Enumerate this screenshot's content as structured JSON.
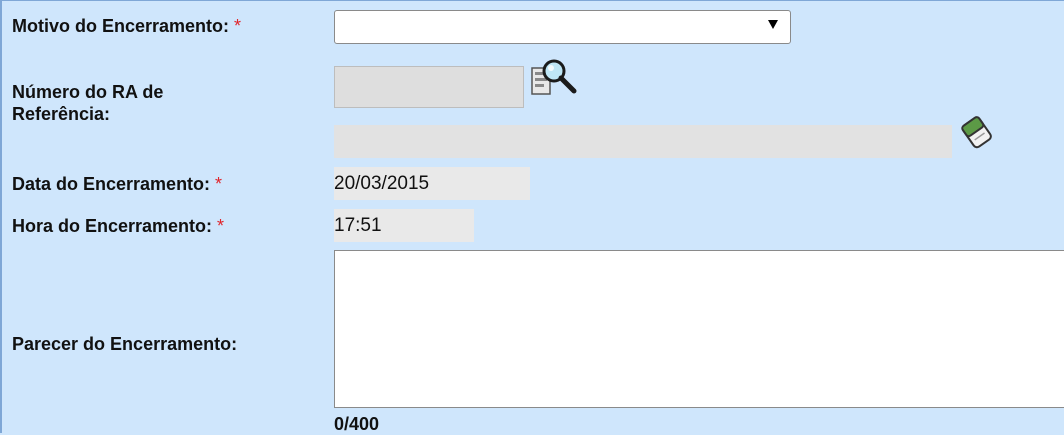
{
  "form": {
    "motivo": {
      "label": "Motivo do Encerramento:",
      "required_mark": "*",
      "selected_value": ""
    },
    "numero_ra": {
      "label_line1": "Número do RA de",
      "label_line2": "Referência:",
      "value": "",
      "description_value": "",
      "search_icon": "magnifier-search-icon",
      "clear_icon": "eraser-icon"
    },
    "data": {
      "label": "Data do Encerramento:",
      "required_mark": "*",
      "value": "20/03/2015"
    },
    "hora": {
      "label": "Hora do Encerramento:",
      "required_mark": "*",
      "value": "17:51"
    },
    "parecer": {
      "label": "Parecer do Encerramento:",
      "value": "",
      "counter": "0/400"
    }
  },
  "colors": {
    "background": "#cfe6fc",
    "required": "#e0242a"
  }
}
